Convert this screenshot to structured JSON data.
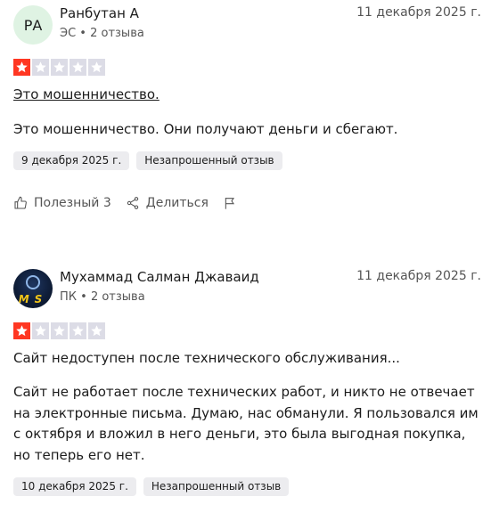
{
  "reviews": [
    {
      "avatar_initials": "РА",
      "name": "Ранбутан А",
      "meta": "ЭС • 2 отзыва",
      "date": "11 декабря 2025 г.",
      "rating": 1,
      "title": "Это мошенничество.",
      "body": "Это мошенничество. Они получают деньги и сбегают.",
      "chips": [
        "9 декабря 2025 г.",
        "Незапрошенный отзыв"
      ],
      "actions": {
        "useful": "Полезный 3",
        "share": "Делиться"
      }
    },
    {
      "avatar_text": "MS",
      "name": "Мухаммад Салман Джаваид",
      "meta": "ПК • 2 отзыва",
      "date": "11 декабря 2025 г.",
      "rating": 1,
      "title": "Сайт недоступен после технического обслуживания...",
      "body": "Сайт не работает после технических работ, и никто не отвечает на электронные письма. Думаю, нас обманули. Я пользовался им с октября и вложил в него деньги, это была выгодная покупка, но теперь его нет.",
      "chips": [
        "10 декабря 2025 г.",
        "Незапрошенный отзыв"
      ]
    }
  ],
  "colors": {
    "star_on": "#ff3722",
    "star_off": "#dcdce6",
    "avatar_bg": "#dff3e3",
    "chip_bg": "#ececef"
  }
}
